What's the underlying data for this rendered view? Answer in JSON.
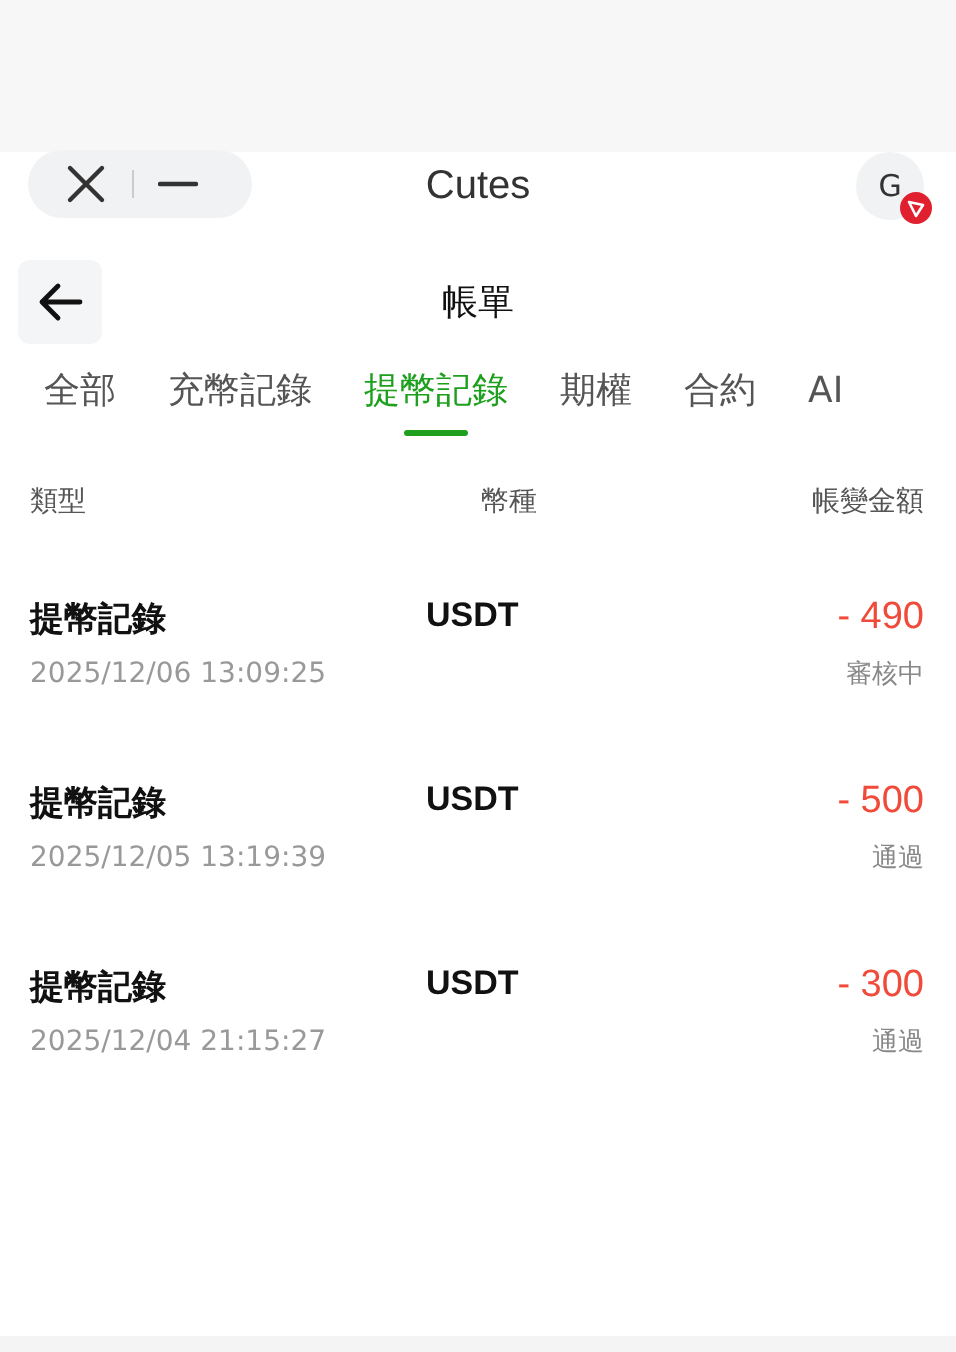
{
  "app_bar": {
    "title": "Cutes",
    "avatar": "G"
  },
  "header": {
    "title": "帳單"
  },
  "tabs": [
    {
      "label": "全部",
      "selected": false
    },
    {
      "label": "充幣記錄",
      "selected": false
    },
    {
      "label": "提幣記錄",
      "selected": true
    },
    {
      "label": "期權",
      "selected": false
    },
    {
      "label": "合約",
      "selected": false
    },
    {
      "label": "AI",
      "selected": false
    }
  ],
  "table": {
    "columns": [
      "類型",
      "幣種",
      "帳變金額"
    ],
    "rows": [
      {
        "type": "提幣記錄",
        "time": "2025/12/06 13:09:25",
        "currency": "USDT",
        "amount": "- 490",
        "status": "審核中"
      },
      {
        "type": "提幣記錄",
        "time": "2025/12/05 13:19:39",
        "currency": "USDT",
        "amount": "- 500",
        "status": "通過"
      },
      {
        "type": "提幣記錄",
        "time": "2025/12/04 21:15:27",
        "currency": "USDT",
        "amount": "- 300",
        "status": "通過"
      }
    ]
  }
}
